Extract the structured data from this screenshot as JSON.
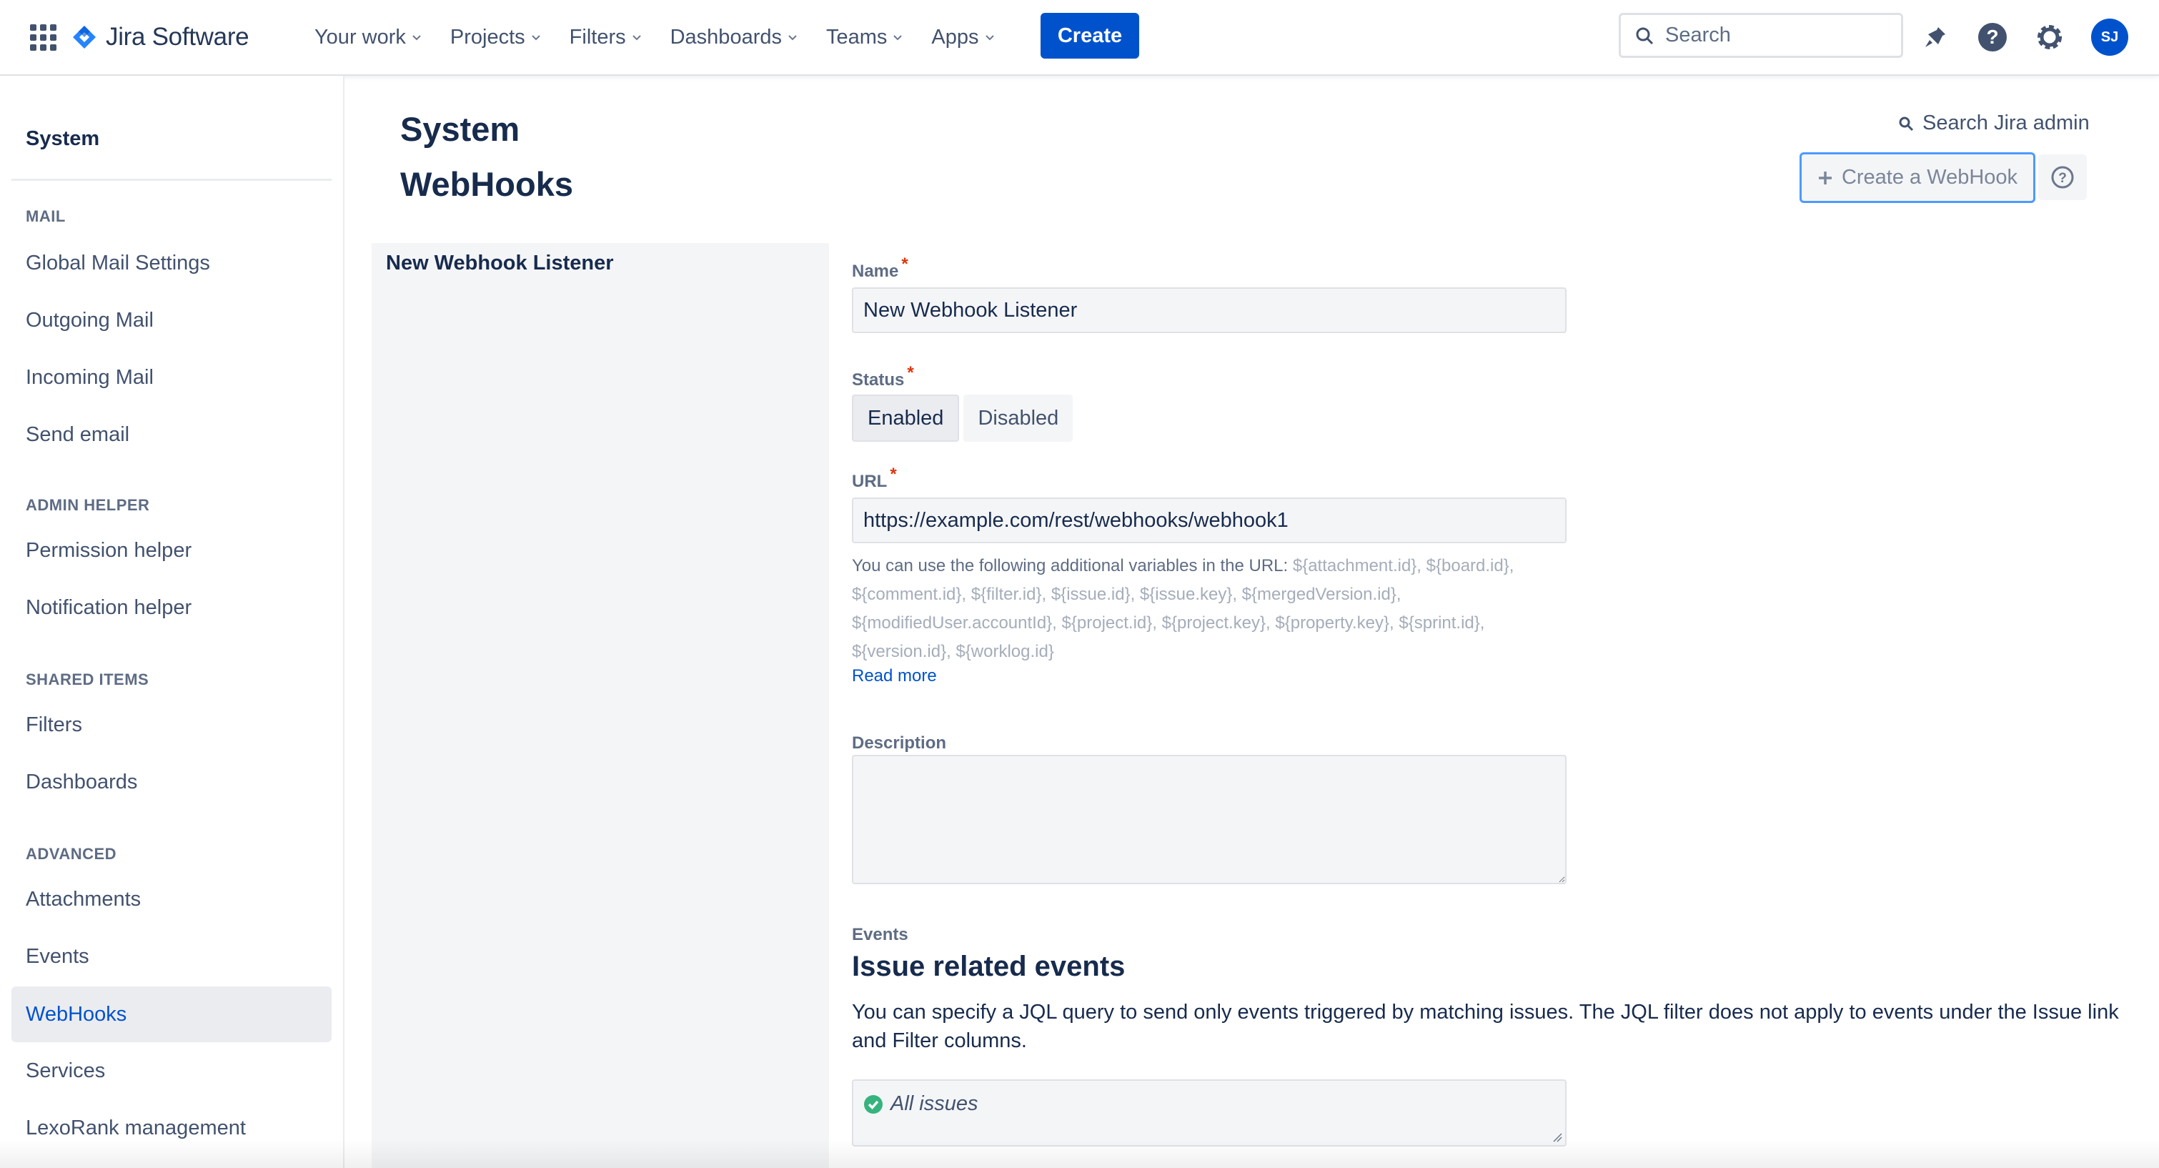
{
  "app": {
    "name": "Jira Software",
    "brand_color": "#0052cc"
  },
  "topnav": {
    "items": [
      {
        "label": "Your work"
      },
      {
        "label": "Projects"
      },
      {
        "label": "Filters"
      },
      {
        "label": "Dashboards"
      },
      {
        "label": "Teams"
      },
      {
        "label": "Apps"
      }
    ],
    "create_label": "Create",
    "search_placeholder": "Search",
    "avatar_initials": "SJ",
    "icons": [
      "app-switcher-icon",
      "notifications-icon",
      "help-icon",
      "settings-icon"
    ]
  },
  "sidebar": {
    "title": "System",
    "sections": [
      {
        "heading": "MAIL",
        "items": [
          "Global Mail Settings",
          "Outgoing Mail",
          "Incoming Mail",
          "Send email"
        ]
      },
      {
        "heading": "ADMIN HELPER",
        "items": [
          "Permission helper",
          "Notification helper"
        ]
      },
      {
        "heading": "SHARED ITEMS",
        "items": [
          "Filters",
          "Dashboards"
        ]
      },
      {
        "heading": "ADVANCED",
        "items": [
          "Attachments",
          "Events",
          "WebHooks",
          "Services",
          "LexoRank management"
        ]
      }
    ],
    "active_item": "WebHooks"
  },
  "main": {
    "title": "System WebHooks",
    "admin_search_label": "Search Jira admin",
    "create_webhook_label": "Create a WebHook",
    "listener_item": "New Webhook Listener",
    "form": {
      "name_label": "Name",
      "name_value": "New Webhook Listener",
      "status_label": "Status",
      "status_options": [
        "Enabled",
        "Disabled"
      ],
      "status_selected": "Enabled",
      "url_label": "URL",
      "url_value": "https://example.com/rest/webhooks/webhook1",
      "url_help_prefix": "You can use the following additional variables in the URL: ",
      "url_help_vars": "${attachment.id}, ${board.id}, ${comment.id}, ${filter.id}, ${issue.id}, ${issue.key}, ${mergedVersion.id}, ${modifiedUser.accountId}, ${project.id}, ${project.key}, ${property.key}, ${sprint.id}, ${version.id}, ${worklog.id}",
      "read_more": "Read more",
      "description_label": "Description",
      "description_value": "",
      "events_label": "Events",
      "events_heading": "Issue related events",
      "events_description": "You can specify a JQL query to send only events triggered by matching issues. The JQL filter does not apply to events under the Issue link and Filter columns.",
      "jql_value": "All issues"
    }
  }
}
